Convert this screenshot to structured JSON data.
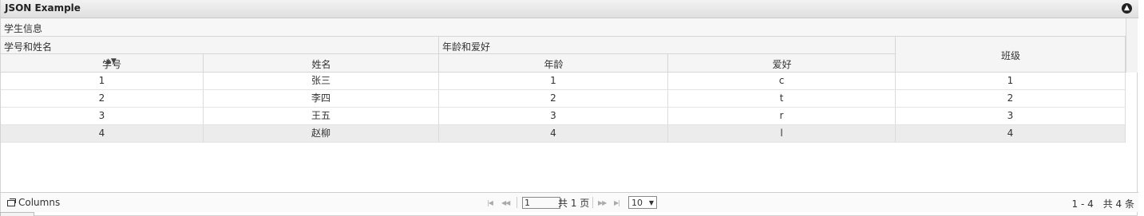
{
  "grid": {
    "title": "JSON Example",
    "caption": "学生信息",
    "groups": {
      "id_name": "学号和姓名",
      "age_hobby": "年龄和爱好"
    },
    "columns": {
      "id": "学号",
      "name": "姓名",
      "age": "年龄",
      "hobby": "爱好",
      "class": "班级"
    },
    "sort_icon": "sort-arrows-icon",
    "rows": [
      {
        "id": "1",
        "name": "张三",
        "age": "1",
        "hobby": "c",
        "class": "1"
      },
      {
        "id": "2",
        "name": "李四",
        "age": "2",
        "hobby": "t",
        "class": "2"
      },
      {
        "id": "3",
        "name": "王五",
        "age": "3",
        "hobby": "r",
        "class": "3"
      },
      {
        "id": "4",
        "name": "赵柳",
        "age": "4",
        "hobby": "l",
        "class": "4"
      }
    ]
  },
  "pager": {
    "columns_label": "Columns",
    "page_value": "1",
    "total_pages_label": "共 1 页",
    "rows_per_page": "10",
    "info": "1 - 4　共 4 条"
  }
}
